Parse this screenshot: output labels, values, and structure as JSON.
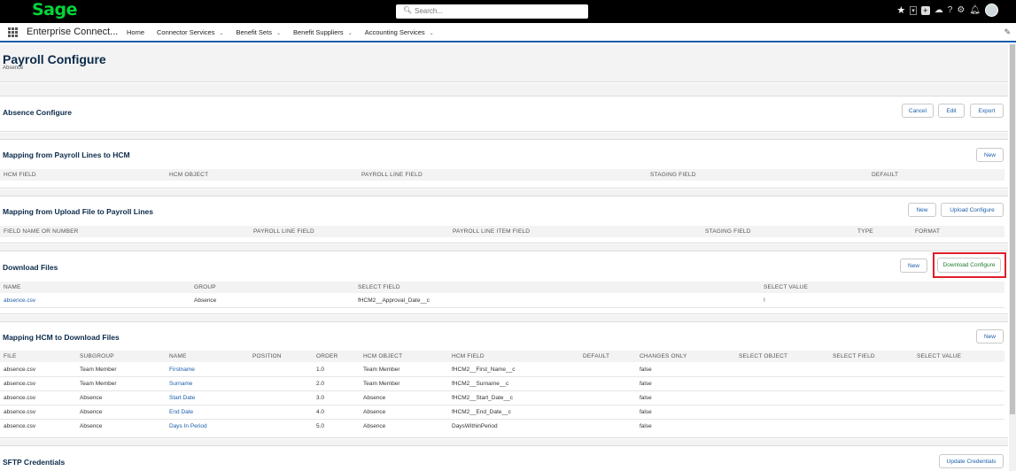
{
  "topbar": {
    "logo": "Sage",
    "search_placeholder": "Search...",
    "icons": [
      "star-icon",
      "chevron-down-icon",
      "add-icon",
      "cloud-icon",
      "help-icon",
      "gear-icon",
      "bell-icon",
      "avatar"
    ]
  },
  "nav": {
    "app_name": "Enterprise Connect...",
    "items": [
      {
        "label": "Home",
        "has_menu": false
      },
      {
        "label": "Connector Services",
        "has_menu": true
      },
      {
        "label": "Benefit Sets",
        "has_menu": true
      },
      {
        "label": "Benefit Suppliers",
        "has_menu": true
      },
      {
        "label": "Accounting Services",
        "has_menu": true
      }
    ]
  },
  "page": {
    "title": "Payroll Configure",
    "subtitle": "Absence"
  },
  "absence_configure": {
    "title": "Absence Configure",
    "buttons": {
      "cancel": "Cancel",
      "edit": "Edit",
      "export": "Export"
    }
  },
  "mapping_payroll_hcm": {
    "title": "Mapping from Payroll Lines to HCM",
    "new_label": "New",
    "columns": [
      "HCM FIELD",
      "HCM OBJECT",
      "PAYROLL LINE FIELD",
      "STAGING FIELD",
      "DEFAULT"
    ]
  },
  "mapping_upload": {
    "title": "Mapping from Upload File to Payroll Lines",
    "new_label": "New",
    "upload_label": "Upload Configure",
    "columns": [
      "FIELD NAME OR NUMBER",
      "PAYROLL LINE FIELD",
      "PAYROLL LINE ITEM FIELD",
      "STAGING FIELD",
      "TYPE",
      "FORMAT"
    ]
  },
  "download_files": {
    "title": "Download Files",
    "new_label": "New",
    "download_label": "Download Configure",
    "columns": [
      "NAME",
      "GROUP",
      "SELECT FIELD",
      "SELECT VALUE"
    ],
    "rows": [
      {
        "name": "absence.csv",
        "group": "Absence",
        "select_field": "fHCM2__Approval_Date__c",
        "select_value": "!"
      }
    ]
  },
  "mapping_hcm_download": {
    "title": "Mapping HCM to Download Files",
    "new_label": "New",
    "columns": [
      "FILE",
      "SUBGROUP",
      "NAME",
      "POSITION",
      "ORDER",
      "HCM OBJECT",
      "HCM FIELD",
      "DEFAULT",
      "CHANGES ONLY",
      "SELECT OBJECT",
      "SELECT FIELD",
      "SELECT VALUE"
    ],
    "rows": [
      {
        "file": "absence.csv",
        "subgroup": "Team Member",
        "name": "Firstname",
        "order": "1.0",
        "hcm_object": "Team Member",
        "hcm_field": "fHCM2__First_Name__c",
        "changes_only": "false"
      },
      {
        "file": "absence.csv",
        "subgroup": "Team Member",
        "name": "Surname",
        "order": "2.0",
        "hcm_object": "Team Member",
        "hcm_field": "fHCM2__Surname__c",
        "changes_only": "false"
      },
      {
        "file": "absence.csv",
        "subgroup": "Absence",
        "name": "Start Date",
        "order": "3.0",
        "hcm_object": "Absence",
        "hcm_field": "fHCM2__Start_Date__c",
        "changes_only": "false"
      },
      {
        "file": "absence.csv",
        "subgroup": "Absence",
        "name": "End Date",
        "order": "4.0",
        "hcm_object": "Absence",
        "hcm_field": "fHCM2__End_Date__c",
        "changes_only": "false"
      },
      {
        "file": "absence.csv",
        "subgroup": "Absence",
        "name": "Days In Period",
        "order": "5.0",
        "hcm_object": "Absence",
        "hcm_field": "DaysWithinPeriod",
        "changes_only": "false"
      }
    ]
  },
  "sftp": {
    "title": "SFTP Credentials",
    "update_label": "Update Credentials"
  },
  "colors": {
    "brand": "#00d639",
    "link": "#1b5eab",
    "highlight": "#e01e2a"
  }
}
